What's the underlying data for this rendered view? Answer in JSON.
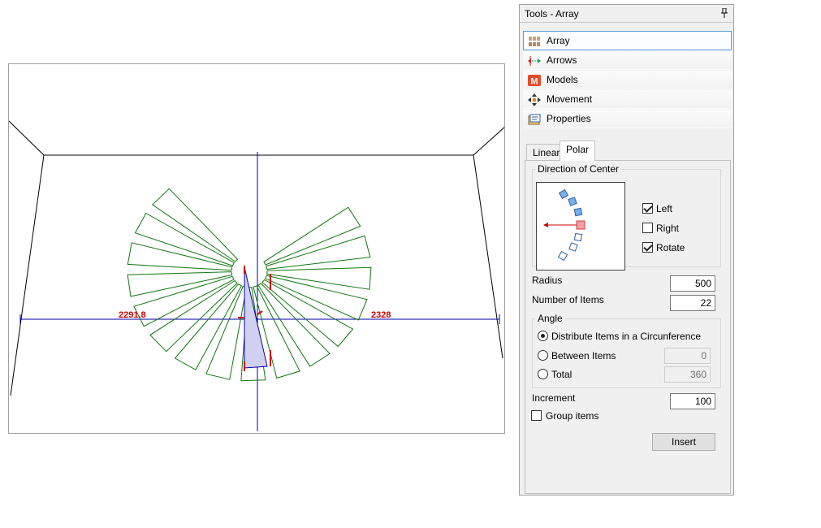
{
  "viewport": {
    "dimensions": {
      "left": "2291.8",
      "right": "2328"
    },
    "colors": {
      "stairs": "#117511",
      "axis": "#0000aa",
      "dim_text": "#cc0000",
      "wall": "#000000",
      "fill": "#d0d0f0"
    }
  },
  "panel": {
    "title": "Tools - Array",
    "pin_icon": "pin-icon",
    "tools": [
      {
        "label": "Array",
        "icon": "array-icon",
        "selected": true
      },
      {
        "label": "Arrows",
        "icon": "arrows-icon",
        "selected": false
      },
      {
        "label": "Models",
        "icon": "models-icon",
        "selected": false
      },
      {
        "label": "Movement",
        "icon": "movement-icon",
        "selected": false
      },
      {
        "label": "Properties",
        "icon": "properties-icon",
        "selected": false
      }
    ],
    "tabs": [
      {
        "label": "Linear",
        "active": false
      },
      {
        "label": "Polar",
        "active": true
      }
    ],
    "direction": {
      "legend": "Direction of Center",
      "left_label": "Left",
      "left_checked": true,
      "right_label": "Right",
      "right_checked": false,
      "rotate_label": "Rotate",
      "rotate_checked": true
    },
    "radius": {
      "label": "Radius",
      "value": "500"
    },
    "items": {
      "label": "Number of Items",
      "value": "22"
    },
    "angle": {
      "legend": "Angle",
      "distribute_label": "Distribute Items in a Circunference",
      "between_label": "Between Items",
      "between_value": "0",
      "total_label": "Total",
      "total_value": "360",
      "selected": "distribute"
    },
    "increment": {
      "label": "Increment",
      "value": "100"
    },
    "group_items": {
      "label": "Group items",
      "checked": false
    },
    "insert_label": "Insert"
  }
}
